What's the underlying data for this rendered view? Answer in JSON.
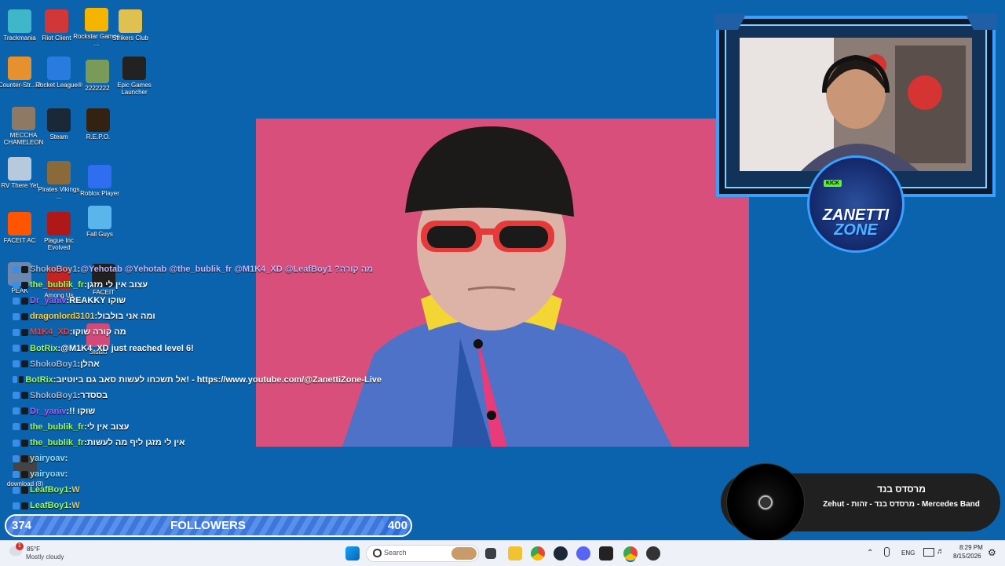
{
  "desktop_icons": [
    {
      "label": "Trackmania",
      "color": "#3fb7c9"
    },
    {
      "label": "Riot Client",
      "color": "#d13639"
    },
    {
      "label": "Rockstar Games ...",
      "color": "#f4b400"
    },
    {
      "label": "Strikers Club",
      "color": "#e0c050"
    },
    {
      "label": "Counter-Str... 2",
      "color": "#e7902e"
    },
    {
      "label": "Rocket League®",
      "color": "#2a7be0"
    },
    {
      "label": "2222222",
      "color": "#7a9a5a"
    },
    {
      "label": "Epic Games Launcher",
      "color": "#222222"
    },
    {
      "label": "MECCHA CHAMELEON",
      "color": "#8e7a64"
    },
    {
      "label": "Steam",
      "color": "#1b2838"
    },
    {
      "label": "R.E.P.O.",
      "color": "#332211"
    },
    {
      "label": "RV There Yet",
      "color": "#b6c9dd"
    },
    {
      "label": "Pirates Vikings ...",
      "color": "#8a6a3a"
    },
    {
      "label": "Roblox Player",
      "color": "#2f6ef0"
    },
    {
      "label": "Fall Guys",
      "color": "#5ab6ea"
    },
    {
      "label": "FACEIT AC",
      "color": "#ff5500"
    },
    {
      "label": "Plague Inc Evolved",
      "color": "#b01818"
    },
    {
      "label": "PEAK",
      "color": "#6a88b0"
    },
    {
      "label": "Among Us",
      "color": "#c42323"
    },
    {
      "label": "FACEIT",
      "color": "#202020"
    },
    {
      "label": "Studio",
      "color": "#d14a7a"
    },
    {
      "label": "download (8)",
      "color": "#444444"
    }
  ],
  "webcam": {
    "logo_line1": "ZANETTI",
    "logo_line2": "ZONE",
    "logo_tag": "KICK"
  },
  "chat": [
    {
      "user": "ShokoBoy1",
      "color": "#9db7d6",
      "msg": "@Yehotab @Yehotab @the_bublik_fr @M1K4_XD @LeafBoy1 ?מה קורה",
      "msg_color": "#c5b8ff"
    },
    {
      "user": "the_bublik_fr",
      "color": "#9cff5a",
      "msg": "עצוב אין לי מזגן",
      "msg_color": "#ffffff"
    },
    {
      "user": "Dr_yaniv",
      "color": "#a65cff",
      "msg": "REAKKY שוקו",
      "msg_color": "#ffffff"
    },
    {
      "user": "dragonlord3101",
      "color": "#ffd23c",
      "msg": "ומה אני בולבול",
      "msg_color": "#ffffff"
    },
    {
      "user": "M1K4_XD",
      "color": "#ff3b3b",
      "msg": "מה קורה שוקו",
      "msg_color": "#ffffff"
    },
    {
      "user": "BotRix",
      "color": "#9cff5a",
      "msg": "@M1K4_XD just reached level 6!",
      "msg_color": "#ffffff"
    },
    {
      "user": "ShokoBoy1",
      "color": "#9db7d6",
      "msg": "אהלן",
      "msg_color": "#ffffff"
    },
    {
      "user": "BotRix",
      "color": "#9cff5a",
      "msg": "אל תשכחו לעשות סאב גם ביוטיוב! - https://www.youtube.com/@ZanettiZone-Live",
      "msg_color": "#ffffff"
    },
    {
      "user": "ShokoBoy1",
      "color": "#9db7d6",
      "msg": "בססדר",
      "msg_color": "#ffffff"
    },
    {
      "user": "Dr_yaniv",
      "color": "#a65cff",
      "msg": "!! שוקו",
      "msg_color": "#ffffff"
    },
    {
      "user": "the_bublik_fr",
      "color": "#9cff5a",
      "msg": "עצוב אין לי",
      "msg_color": "#ffffff"
    },
    {
      "user": "the_bublik_fr",
      "color": "#9cff5a",
      "msg": "אין לי מזגן ליף מה לעשות",
      "msg_color": "#ffffff"
    },
    {
      "user": "yairyoav",
      "color": "#8fe3ff",
      "msg": "",
      "msg_color": "#ffffff"
    },
    {
      "user": "yairyoav",
      "color": "#8fe3ff",
      "msg": "",
      "msg_color": "#ffffff"
    },
    {
      "user": "LeafBoy1",
      "color": "#9cff5a",
      "msg": "W",
      "msg_color": "#e8c84a"
    },
    {
      "user": "LeafBoy1",
      "color": "#9cff5a",
      "msg": "W",
      "msg_color": "#e8c84a"
    }
  ],
  "followers": {
    "current": "374",
    "label": "FOLLOWERS",
    "goal": "400",
    "progress_fraction": 0.935
  },
  "now_playing": {
    "title": "מרסדס בנד",
    "subtitle": "Mercedes Band - מרסדס בנד - זהות - Zehut"
  },
  "taskbar": {
    "weather_temp": "85°F",
    "weather_desc": "Mostly cloudy",
    "search_placeholder": "Search",
    "lang": "ENG",
    "time": "8:29 PM",
    "date": "8/15/2026",
    "notification_count": "1"
  }
}
